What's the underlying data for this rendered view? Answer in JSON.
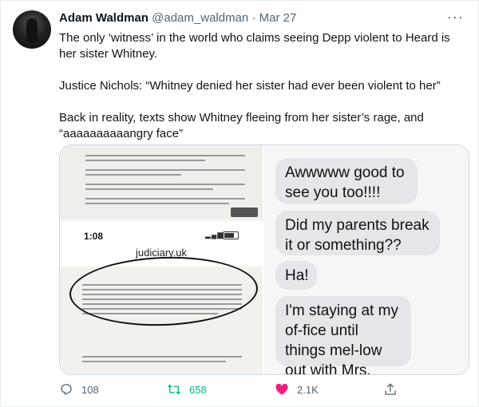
{
  "author": {
    "name": "Adam Waldman",
    "handle": "@adam_waldman",
    "separator": "·",
    "date": "Mar 27"
  },
  "more_label": "···",
  "tweet_text": [
    "The only ‘witness’ in the world who claims seeing Depp violent to Heard is her sister Whitney.",
    "Justice Nichols: “Whitney denied her sister had ever been violent to her”",
    "Back in reality, texts show Whitney fleeing from her sister’s rage, and “aaaaaaaaaangry face”"
  ],
  "media": {
    "left": {
      "phone_time": "1:08",
      "url": "judiciary.uk"
    },
    "right": {
      "messages": [
        "Awwwww good to see you too!!!!",
        "Did my parents break it or something??",
        "Ha!",
        "I'm staying at my of-fice until things mel-low out with Mrs. Depp.... 😒"
      ]
    }
  },
  "actions": {
    "reply_count": "108",
    "retweet_count": "658",
    "like_count": "2.1K"
  },
  "colors": {
    "retweet": "#00ba7c",
    "like": "#f91880",
    "secondary_text": "#536471",
    "bubble": "#e5e5ea"
  },
  "icons": [
    "reply-icon",
    "retweet-icon",
    "like-icon",
    "share-icon",
    "more-icon"
  ]
}
